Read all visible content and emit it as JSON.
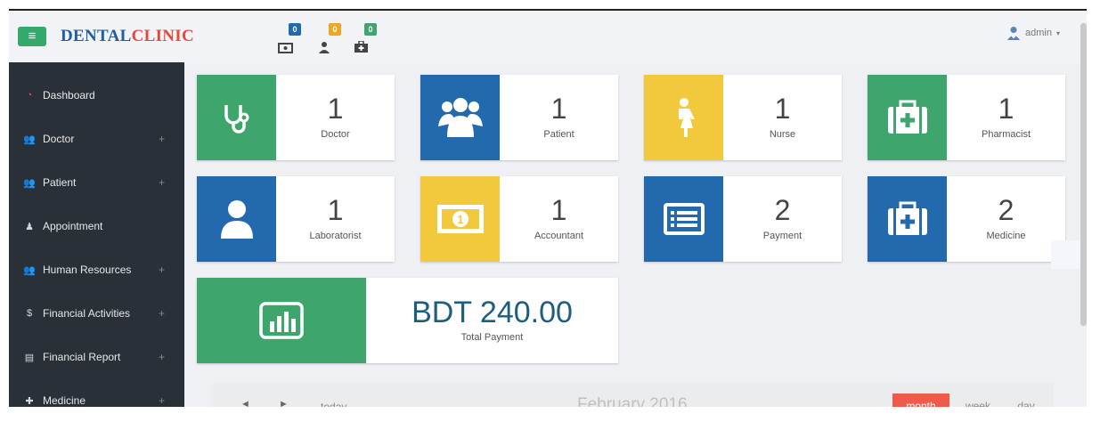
{
  "header": {
    "brand_part1": "DENTAL",
    "brand_part2": "CLINIC",
    "notifications": [
      {
        "icon": "money-icon",
        "count": "0",
        "color": "#2369ad"
      },
      {
        "icon": "user-icon",
        "count": "0",
        "color": "#f0a623"
      },
      {
        "icon": "medkit-icon",
        "count": "0",
        "color": "#3ea66c"
      }
    ],
    "user_label": "admin",
    "user_caret": "▾"
  },
  "sidebar": {
    "items": [
      {
        "label": "Dashboard",
        "icon": "dashboard-icon",
        "arrow": ""
      },
      {
        "label": "Doctor",
        "icon": "users-icon",
        "arrow": "+"
      },
      {
        "label": "Patient",
        "icon": "users-icon",
        "arrow": "+"
      },
      {
        "label": "Appointment",
        "icon": "user-icon",
        "arrow": ""
      },
      {
        "label": "Human Resources",
        "icon": "users-icon",
        "arrow": "+"
      },
      {
        "label": "Financial Activities",
        "icon": "dollar-icon",
        "arrow": "+"
      },
      {
        "label": "Financial Report",
        "icon": "book-icon",
        "arrow": "+"
      },
      {
        "label": "Medicine",
        "icon": "medkit-icon",
        "arrow": "+"
      }
    ]
  },
  "stats": [
    {
      "value": "1",
      "label": "Doctor",
      "icon": "stethoscope-icon",
      "color": "#3ea66c"
    },
    {
      "value": "1",
      "label": "Patient",
      "icon": "users-icon",
      "color": "#2369ad"
    },
    {
      "value": "1",
      "label": "Nurse",
      "icon": "female-icon",
      "color": "#f2c93c"
    },
    {
      "value": "1",
      "label": "Pharmacist",
      "icon": "medkit-icon",
      "color": "#3ea66c"
    },
    {
      "value": "1",
      "label": "Laboratorist",
      "icon": "user-icon",
      "color": "#2369ad"
    },
    {
      "value": "1",
      "label": "Accountant",
      "icon": "money-icon",
      "color": "#f2c93c"
    },
    {
      "value": "2",
      "label": "Payment",
      "icon": "list-alt-icon",
      "color": "#2369ad"
    },
    {
      "value": "2",
      "label": "Medicine",
      "icon": "medkit-icon",
      "color": "#2369ad"
    }
  ],
  "total": {
    "value": "BDT 240.00",
    "label": "Total Payment",
    "icon": "bar-chart-icon",
    "color": "#3ea66c"
  },
  "calendar": {
    "prev": "◄",
    "next": "►",
    "today": "today",
    "title": "February 2016",
    "views": [
      "month",
      "week",
      "day"
    ],
    "active_view": "month"
  }
}
